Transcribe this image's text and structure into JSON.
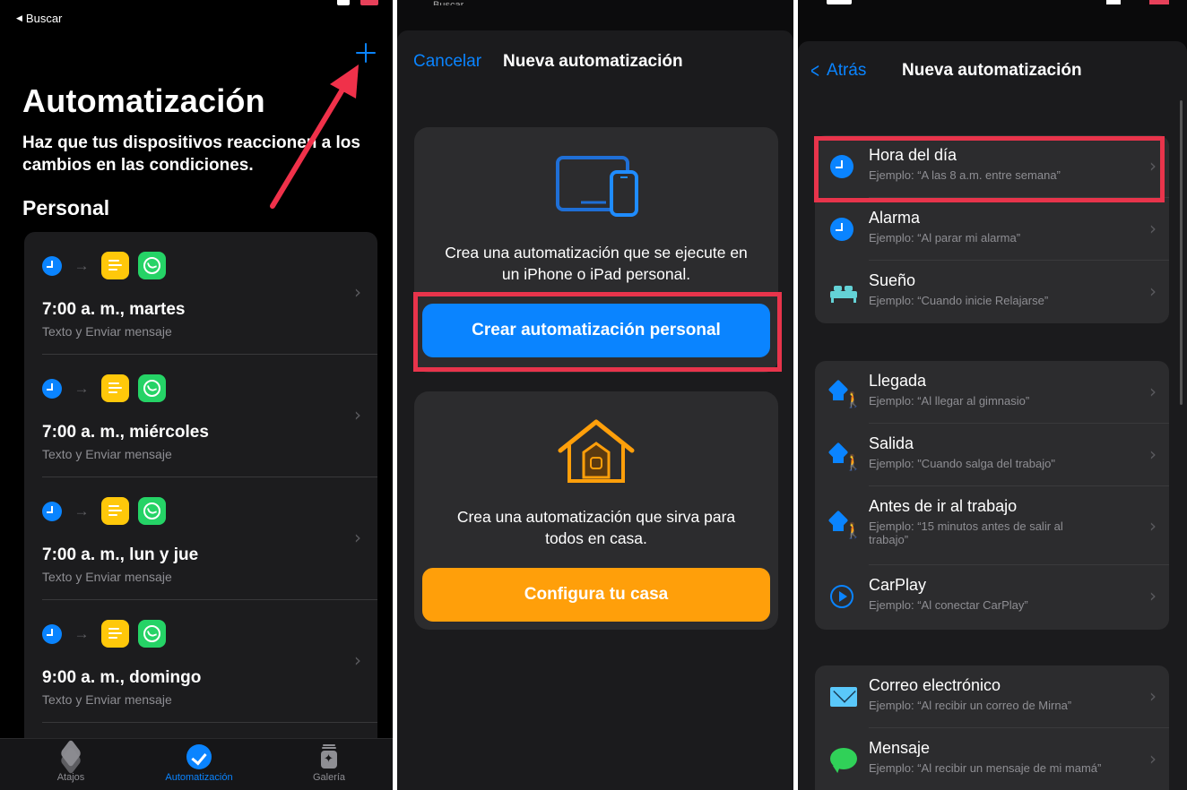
{
  "panel1": {
    "back_label": "Buscar",
    "title": "Automatización",
    "subtitle": "Haz que tus dispositivos reaccionen a los cambios en las condiciones.",
    "section": "Personal",
    "automations": [
      {
        "title": "7:00 a. m., martes",
        "subtitle": "Texto y Enviar mensaje"
      },
      {
        "title": "7:00 a. m., miércoles",
        "subtitle": "Texto y Enviar mensaje"
      },
      {
        "title": "7:00 a. m., lun y jue",
        "subtitle": "Texto y Enviar mensaje"
      },
      {
        "title": "9:00 a. m., domingo",
        "subtitle": "Texto y Enviar mensaje"
      }
    ],
    "tabs": [
      {
        "label": "Atajos",
        "icon": "layers-icon",
        "active": false
      },
      {
        "label": "Automatización",
        "icon": "automation-check-icon",
        "active": true
      },
      {
        "label": "Galería",
        "icon": "gallery-icon",
        "active": false
      }
    ]
  },
  "panel2": {
    "status_text": "Buscar",
    "cancel_label": "Cancelar",
    "title": "Nueva automatización",
    "personal": {
      "line1": "Crea una automatización que se ejecute en",
      "line2": "un iPhone o iPad personal.",
      "button": "Crear automatización personal"
    },
    "home": {
      "line1": "Crea una automatización que sirva para",
      "line2": "todos en casa.",
      "button": "Configura tu casa"
    }
  },
  "panel3": {
    "back_label": "Atrás",
    "title": "Nueva automatización",
    "groups": [
      [
        {
          "title": "Hora del día",
          "subtitle": "Ejemplo: “A las 8 a.m. entre semana”",
          "icon": "clock-icon"
        },
        {
          "title": "Alarma",
          "subtitle": "Ejemplo: “Al parar mi alarma”",
          "icon": "alarm-clock-icon"
        },
        {
          "title": "Sueño",
          "subtitle": "Ejemplo: “Cuando inicie Relajarse”",
          "icon": "bed-icon"
        }
      ],
      [
        {
          "title": "Llegada",
          "subtitle": "Ejemplo: “Al llegar al gimnasio”",
          "icon": "arrive-home-icon"
        },
        {
          "title": "Salida",
          "subtitle": "Ejemplo: \"Cuando salga del trabajo\"",
          "icon": "leave-home-icon"
        },
        {
          "title": "Antes de ir al trabajo",
          "subtitle": "Ejemplo: “15 minutos antes de salir al trabajo”",
          "icon": "commute-icon"
        },
        {
          "title": "CarPlay",
          "subtitle": "Ejemplo: “Al conectar CarPlay”",
          "icon": "carplay-icon"
        }
      ],
      [
        {
          "title": "Correo electrónico",
          "subtitle": "Ejemplo: “Al recibir un correo de Mirna”",
          "icon": "mail-icon"
        },
        {
          "title": "Mensaje",
          "subtitle": "Ejemplo: “Al recibir un mensaje de mi mamá”",
          "icon": "message-icon"
        }
      ]
    ]
  },
  "colors": {
    "accent_blue": "#0a84ff",
    "highlight_red": "#e8344b",
    "home_orange": "#ff9f0a",
    "shortcut_yellow": "#ffc80a",
    "whatsapp_green": "#25d366"
  }
}
